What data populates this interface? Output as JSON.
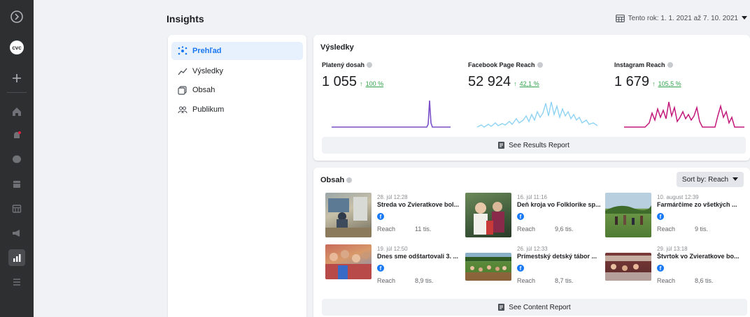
{
  "header": {
    "title": "Insights",
    "date_range": "Tento rok: 1. 1. 2021 až 7. 10. 2021"
  },
  "nav": {
    "items": [
      {
        "label": "Prehľad",
        "icon": "overview-icon",
        "active": true
      },
      {
        "label": "Výsledky",
        "icon": "results-icon",
        "active": false
      },
      {
        "label": "Obsah",
        "icon": "content-icon",
        "active": false
      },
      {
        "label": "Publikum",
        "icon": "audience-icon",
        "active": false
      }
    ]
  },
  "results": {
    "title": "Výsledky",
    "metrics": [
      {
        "label": "Platený dosah",
        "value": "1 055",
        "change": "100 %",
        "color": "#7a4fc9"
      },
      {
        "label": "Facebook Page Reach",
        "value": "52 924",
        "change": "42,1 %",
        "color": "#8fd3f4"
      },
      {
        "label": "Instagram Reach",
        "value": "1 679",
        "change": "105,5 %",
        "color": "#c2187a"
      }
    ],
    "report_button": "See Results Report"
  },
  "content": {
    "title": "Obsah",
    "sort_label": "Sort by: Reach",
    "posts": [
      {
        "date": "28. júl 12:28",
        "title": "Streda vo Zvieratkove bol...",
        "reach_label": "Reach",
        "reach": "11 tis."
      },
      {
        "date": "16. júl 11:16",
        "title": "Deň kroja vo Folklorike sp...",
        "reach_label": "Reach",
        "reach": "9,6 tis."
      },
      {
        "date": "10. august 12:39",
        "title": "Farmárčime zo všetkých ...",
        "reach_label": "Reach",
        "reach": "9 tis."
      },
      {
        "date": "19. júl 12:50",
        "title": "Dnes sme odštartovali 3. ...",
        "reach_label": "Reach",
        "reach": "8,9 tis."
      },
      {
        "date": "26. júl 12:33",
        "title": "Prímestský detský tábor ...",
        "reach_label": "Reach",
        "reach": "8,7 tis."
      },
      {
        "date": "29. júl 13:18",
        "title": "Štvrtok vo Zvieratkove bo...",
        "reach_label": "Reach",
        "reach": "8,6 tis."
      }
    ],
    "report_button": "See Content Report"
  },
  "colors": {
    "accent": "#1877f2",
    "positive": "#31a24c"
  }
}
